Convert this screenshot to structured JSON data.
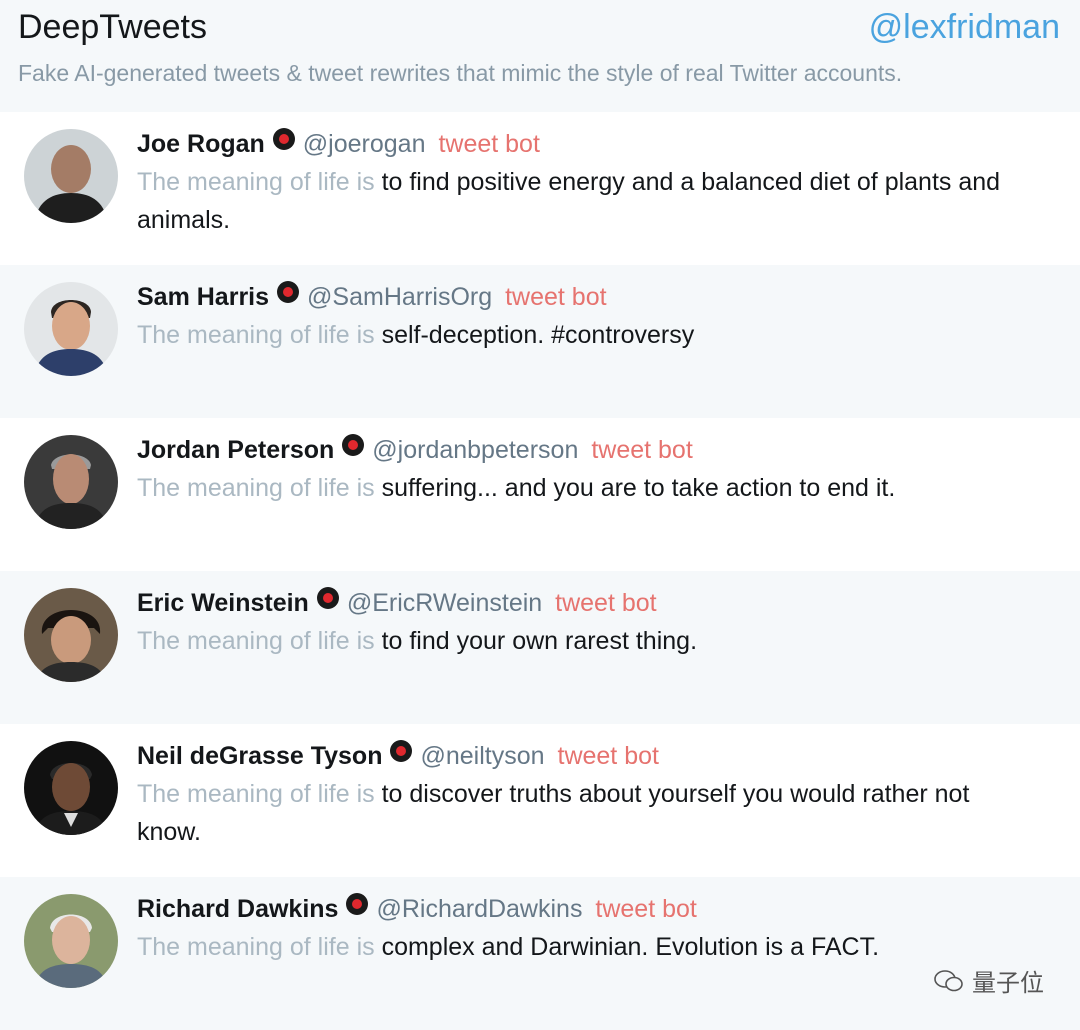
{
  "header": {
    "title": "DeepTweets",
    "account": "@lexfridman",
    "subtitle": "Fake AI-generated tweets & tweet rewrites that mimic the style of real Twitter accounts."
  },
  "tweets": [
    {
      "name": "Joe Rogan",
      "handle": "@joerogan",
      "bot_label": "tweet bot",
      "prefix": "The meaning of life is",
      "text": " to find positive energy and a balanced diet of plants and animals."
    },
    {
      "name": "Sam Harris",
      "handle": "@SamHarrisOrg",
      "bot_label": "tweet bot",
      "prefix": "The meaning of life is",
      "text": " self-deception. #controversy"
    },
    {
      "name": "Jordan Peterson",
      "handle": "@jordanbpeterson",
      "bot_label": "tweet bot",
      "prefix": "The meaning of life is",
      "text": " suffering... and you are to take action to end it."
    },
    {
      "name": "Eric Weinstein",
      "handle": "@EricRWeinstein",
      "bot_label": "tweet bot",
      "prefix": "The meaning of life is",
      "text": " to find your own rarest thing."
    },
    {
      "name": "Neil deGrasse Tyson",
      "handle": "@neiltyson",
      "bot_label": "tweet bot",
      "prefix": "The meaning of life is",
      "text": " to discover truths about yourself you would rather not know."
    },
    {
      "name": "Richard Dawkins",
      "handle": "@RichardDawkins",
      "bot_label": "tweet bot",
      "prefix": "The meaning of life is",
      "text": " complex and Darwinian. Evolution is a FACT."
    }
  ],
  "watermark": "量子位",
  "colors": {
    "accent": "#4aa3df",
    "bot_label": "#e6736f",
    "badge": "#e0282e"
  }
}
